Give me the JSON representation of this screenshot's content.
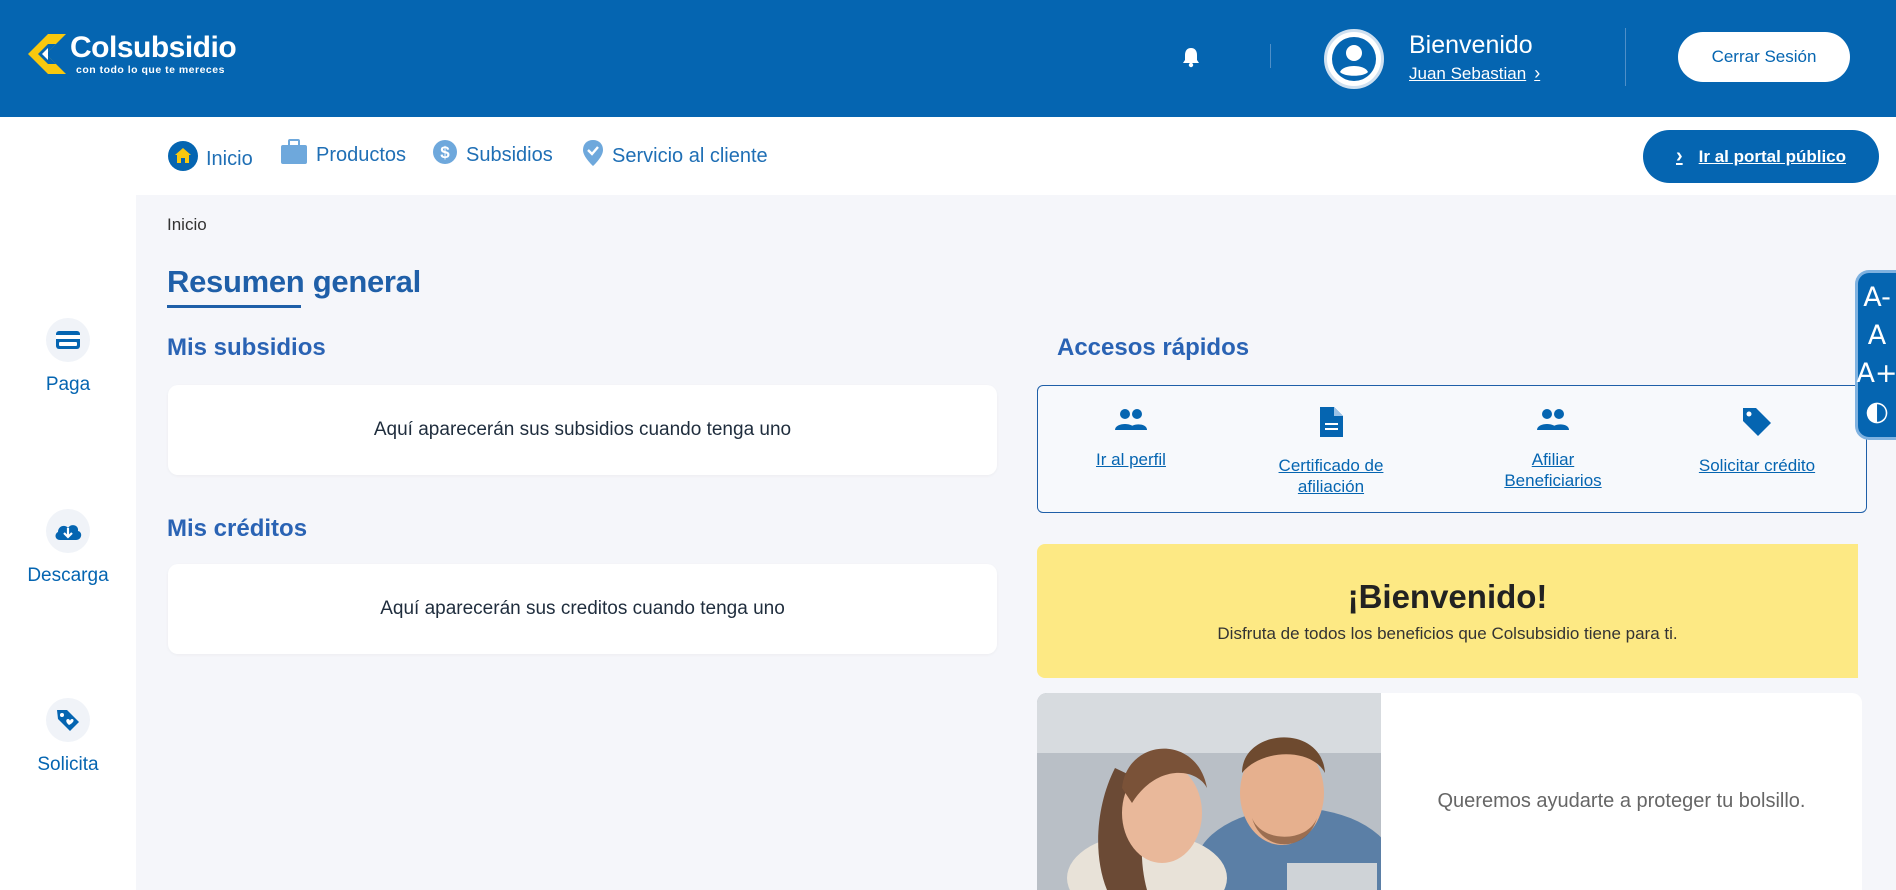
{
  "brand": {
    "name": "Colsubsidio",
    "tagline": "con todo lo que te mereces",
    "primary_color": "#0565b1",
    "accent_color": "#f9c80e"
  },
  "header": {
    "welcome": "Bienvenido",
    "user_name": "Juan Sebastian",
    "logout_label": "Cerrar Sesión"
  },
  "left_rail": {
    "items": [
      {
        "label": "Paga",
        "icon": "credit-card-icon"
      },
      {
        "label": "Descarga",
        "icon": "cloud-download-icon"
      },
      {
        "label": "Solicita",
        "icon": "tag-heart-icon"
      }
    ]
  },
  "nav": {
    "items": [
      {
        "label": "Inicio",
        "icon": "home-icon"
      },
      {
        "label": "Productos",
        "icon": "briefcase-icon"
      },
      {
        "label": "Subsidios",
        "icon": "dollar-icon"
      },
      {
        "label": "Servicio al cliente",
        "icon": "location-check-icon"
      }
    ],
    "portal_label": "Ir al portal público"
  },
  "main": {
    "breadcrumb": "Inicio",
    "title": "Resumen general",
    "subsidios": {
      "title": "Mis subsidios",
      "empty": "Aquí aparecerán sus subsidios cuando tenga uno"
    },
    "creditos": {
      "title": "Mis créditos",
      "empty": "Aquí aparecerán sus creditos cuando tenga uno"
    }
  },
  "quick": {
    "title": "Accesos rápidos",
    "items": [
      {
        "line1": "Ir al perfil",
        "line2": "",
        "icon": "people-icon"
      },
      {
        "line1": "Certificado de",
        "line2": "afiliación",
        "icon": "document-icon"
      },
      {
        "line1": "Afiliar",
        "line2": "Beneficiarios",
        "icon": "people-icon"
      },
      {
        "line1": "Solicitar crédito",
        "line2": "",
        "icon": "tag-icon"
      }
    ]
  },
  "banner": {
    "title": "¡Bienvenido!",
    "subtitle": "Disfruta de todos los beneficios que Colsubsidio tiene para ti.",
    "bg_color": "#fde984"
  },
  "promo": {
    "text": "Queremos ayudarte a proteger tu bolsillo."
  },
  "a11y": {
    "decrease": "A-",
    "normal": "A",
    "increase": "A+",
    "contrast": "◐"
  }
}
